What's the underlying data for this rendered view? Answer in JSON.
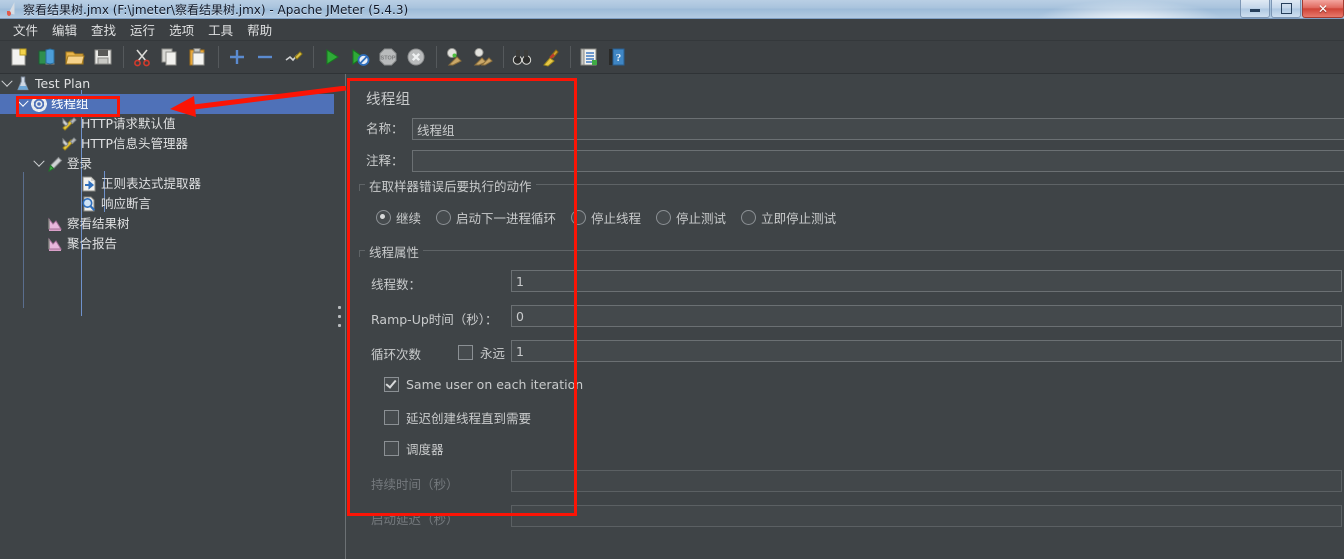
{
  "window": {
    "title": "察看结果树.jmx (F:\\jmeter\\察看结果树.jmx) - Apache JMeter (5.4.3)",
    "app_icon": "jmeter-flask-icon",
    "minimize": "–",
    "maximize": "❐",
    "close": "✕"
  },
  "menubar": {
    "items": [
      {
        "label": "文件",
        "name": "menu-file"
      },
      {
        "label": "编辑",
        "name": "menu-edit"
      },
      {
        "label": "查找",
        "name": "menu-search"
      },
      {
        "label": "运行",
        "name": "menu-run"
      },
      {
        "label": "选项",
        "name": "menu-options"
      },
      {
        "label": "工具",
        "name": "menu-tools"
      },
      {
        "label": "帮助",
        "name": "menu-help"
      }
    ]
  },
  "toolbar": {
    "buttons": [
      {
        "icon": "new-document-icon",
        "name": "toolbar-new"
      },
      {
        "icon": "templates-icon",
        "name": "toolbar-templates"
      },
      {
        "icon": "open-folder-icon",
        "name": "toolbar-open"
      },
      {
        "icon": "save-floppy-icon",
        "name": "toolbar-save"
      },
      {
        "icon": "cut-scissors-icon",
        "name": "toolbar-cut"
      },
      {
        "icon": "copy-icon",
        "name": "toolbar-copy"
      },
      {
        "icon": "paste-clipboard-icon",
        "name": "toolbar-paste"
      },
      {
        "icon": "plus-icon",
        "name": "toolbar-expand-all"
      },
      {
        "icon": "minus-icon",
        "name": "toolbar-collapse-all"
      },
      {
        "icon": "toggle-pencil-icon",
        "name": "toolbar-toggle"
      },
      {
        "icon": "start-play-icon",
        "name": "toolbar-start"
      },
      {
        "icon": "start-no-pauses-icon",
        "name": "toolbar-start-no-pauses"
      },
      {
        "icon": "stop-sign-icon",
        "name": "toolbar-stop"
      },
      {
        "icon": "shutdown-icon",
        "name": "toolbar-shutdown"
      },
      {
        "icon": "clear-broom-icon",
        "name": "toolbar-clear"
      },
      {
        "icon": "clear-all-broom-icon",
        "name": "toolbar-clear-all"
      },
      {
        "icon": "search-binoculars-icon",
        "name": "toolbar-search"
      },
      {
        "icon": "reset-search-broom-icon",
        "name": "toolbar-reset-search"
      },
      {
        "icon": "function-helper-icon",
        "name": "toolbar-function-helper"
      },
      {
        "icon": "help-book-icon",
        "name": "toolbar-help"
      }
    ]
  },
  "tree": {
    "items": [
      {
        "label": "Test Plan",
        "icon": "test-plan-icon",
        "depth": 0,
        "expanded": true,
        "selected": false,
        "name": "tree-item-test-plan"
      },
      {
        "label": "线程组",
        "icon": "thread-group-gear-icon",
        "depth": 1,
        "expanded": true,
        "selected": true,
        "name": "tree-item-thread-group"
      },
      {
        "label": "HTTP请求默认值",
        "icon": "http-defaults-icon",
        "depth": 2,
        "expanded": null,
        "selected": false,
        "name": "tree-item-http-defaults"
      },
      {
        "label": "HTTP信息头管理器",
        "icon": "http-header-manager-icon",
        "depth": 2,
        "expanded": null,
        "selected": false,
        "name": "tree-item-http-header-manager"
      },
      {
        "label": "登录",
        "icon": "http-sampler-icon",
        "depth": 2,
        "expanded": true,
        "selected": false,
        "name": "tree-item-login"
      },
      {
        "label": "正则表达式提取器",
        "icon": "regex-extractor-icon",
        "depth": 3,
        "expanded": null,
        "selected": false,
        "name": "tree-item-regex-extractor"
      },
      {
        "label": "响应断言",
        "icon": "response-assertion-icon",
        "depth": 3,
        "expanded": null,
        "selected": false,
        "name": "tree-item-response-assertion"
      },
      {
        "label": "察看结果树",
        "icon": "view-results-tree-icon",
        "depth": 2,
        "expanded": null,
        "selected": false,
        "name": "tree-item-view-results-tree"
      },
      {
        "label": "聚合报告",
        "icon": "aggregate-report-icon",
        "depth": 2,
        "expanded": null,
        "selected": false,
        "name": "tree-item-aggregate-report"
      }
    ]
  },
  "panel": {
    "title": "线程组",
    "name_label": "名称：",
    "name_value": "线程组",
    "comment_label": "注释：",
    "comment_value": "",
    "error_action": {
      "group_title": "在取样器错误后要执行的动作",
      "options": [
        {
          "label": "继续",
          "selected": true,
          "name": "radio-continue"
        },
        {
          "label": "启动下一进程循环",
          "selected": false,
          "name": "radio-start-next-loop"
        },
        {
          "label": "停止线程",
          "selected": false,
          "name": "radio-stop-thread"
        },
        {
          "label": "停止测试",
          "selected": false,
          "name": "radio-stop-test"
        },
        {
          "label": "立即停止测试",
          "selected": false,
          "name": "radio-stop-test-now"
        }
      ]
    },
    "thread_props": {
      "group_title": "线程属性",
      "threads_label": "线程数：",
      "threads_value": "1",
      "rampup_label": "Ramp-Up时间（秒）：",
      "rampup_value": "0",
      "loops_label": "循环次数",
      "forever_label": "永远",
      "forever_checked": false,
      "loops_value": "1",
      "same_user_label": "Same user on each iteration",
      "same_user_checked": true,
      "delay_create_label": "延迟创建线程直到需要",
      "delay_create_checked": false,
      "scheduler_label": "调度器",
      "scheduler_checked": false,
      "duration_label": "持续时间（秒）",
      "duration_value": "",
      "startup_delay_label": "启动延迟（秒）",
      "startup_delay_value": ""
    }
  },
  "annotations": {
    "accent_color": "#fb1405",
    "highlight_box_name": "red-highlight-rect",
    "tree_highlight_name": "red-tree-highlight-rect",
    "arrow_name": "red-pointer-arrow"
  }
}
